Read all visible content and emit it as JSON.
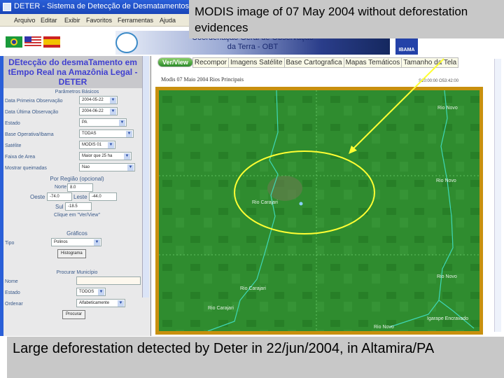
{
  "window": {
    "title": "DETER - Sistema de Detecção de Desmatamentos em Tempo Real"
  },
  "menu": [
    "Arquivo",
    "Editar",
    "Exibir",
    "Favoritos",
    "Ferramentas",
    "Ajuda"
  ],
  "header": {
    "banner_line1": "Coordenação Geral de Observação",
    "banner_line2": "da Terra - OBT",
    "ibama": "IBAMA"
  },
  "left": {
    "title": "DEtecção do desmaTamento em tEmpo Real na Amazônia Legal - DETER",
    "basic_params": "Parâmetros Básicos",
    "fields": [
      {
        "label": "Data Primeira Observação",
        "value": "2004-05-22"
      },
      {
        "label": "Data Última Observação",
        "value": "2004-06-22"
      },
      {
        "label": "Estado",
        "value": "PA"
      },
      {
        "label": "Base Operativa/Ibama",
        "value": "TODAS"
      },
      {
        "label": "Satélite",
        "value": "MODIS 01"
      },
      {
        "label": "Faixa de Area",
        "value": "Maior que 25 ha"
      },
      {
        "label": "Mostrar queimadas",
        "value": "Nao"
      }
    ],
    "region": {
      "title": "Por Região (opcional)",
      "norte_label": "Norte",
      "norte": "8.0",
      "oeste_label": "Oeste",
      "oeste": "-74.0",
      "leste_label": "Leste",
      "leste": "-44.0",
      "sul_label": "Sul",
      "sul": "-18.5",
      "hint": "Clique em \"Ver/View\""
    },
    "graphs": {
      "title": "Gráficos",
      "tipo_label": "Tipo",
      "tipo": "Polinos",
      "button": "Histograma"
    },
    "search": {
      "title": "Procurar Município",
      "nome_label": "Nome",
      "nome": "",
      "estado_label": "Estado",
      "estado": "TODOS",
      "ordenar_label": "Ordenar",
      "ordenar": "Alfabeticamente",
      "button": "Procurar"
    }
  },
  "tabs": [
    "Ver/View",
    "Recompor",
    "Imagens Satélite",
    "Base Cartografica",
    "Mapas Temáticos",
    "Tamanho da Tela"
  ],
  "map": {
    "caption": "Modis 07 Maio 2004 Rios Principais",
    "coords": "S10:00:00 O53:42:00",
    "labels": [
      "Rio Novo",
      "Rio Novo",
      "Rio Carajari",
      "Rio Carajari",
      "Rio Carajari",
      "Rio Novo",
      "Rio Novo",
      "Igarape Encravado"
    ]
  },
  "slide": {
    "annotation": "MODIS  image of  07 May 2004 without deforestation evidences",
    "caption": "Large deforestation detected by Deter in 22/jun/2004, in Altamira/PA"
  },
  "colors": {
    "highlight": "#ffff33",
    "forest": "#2d8a2d",
    "frame": "#c8900e"
  }
}
